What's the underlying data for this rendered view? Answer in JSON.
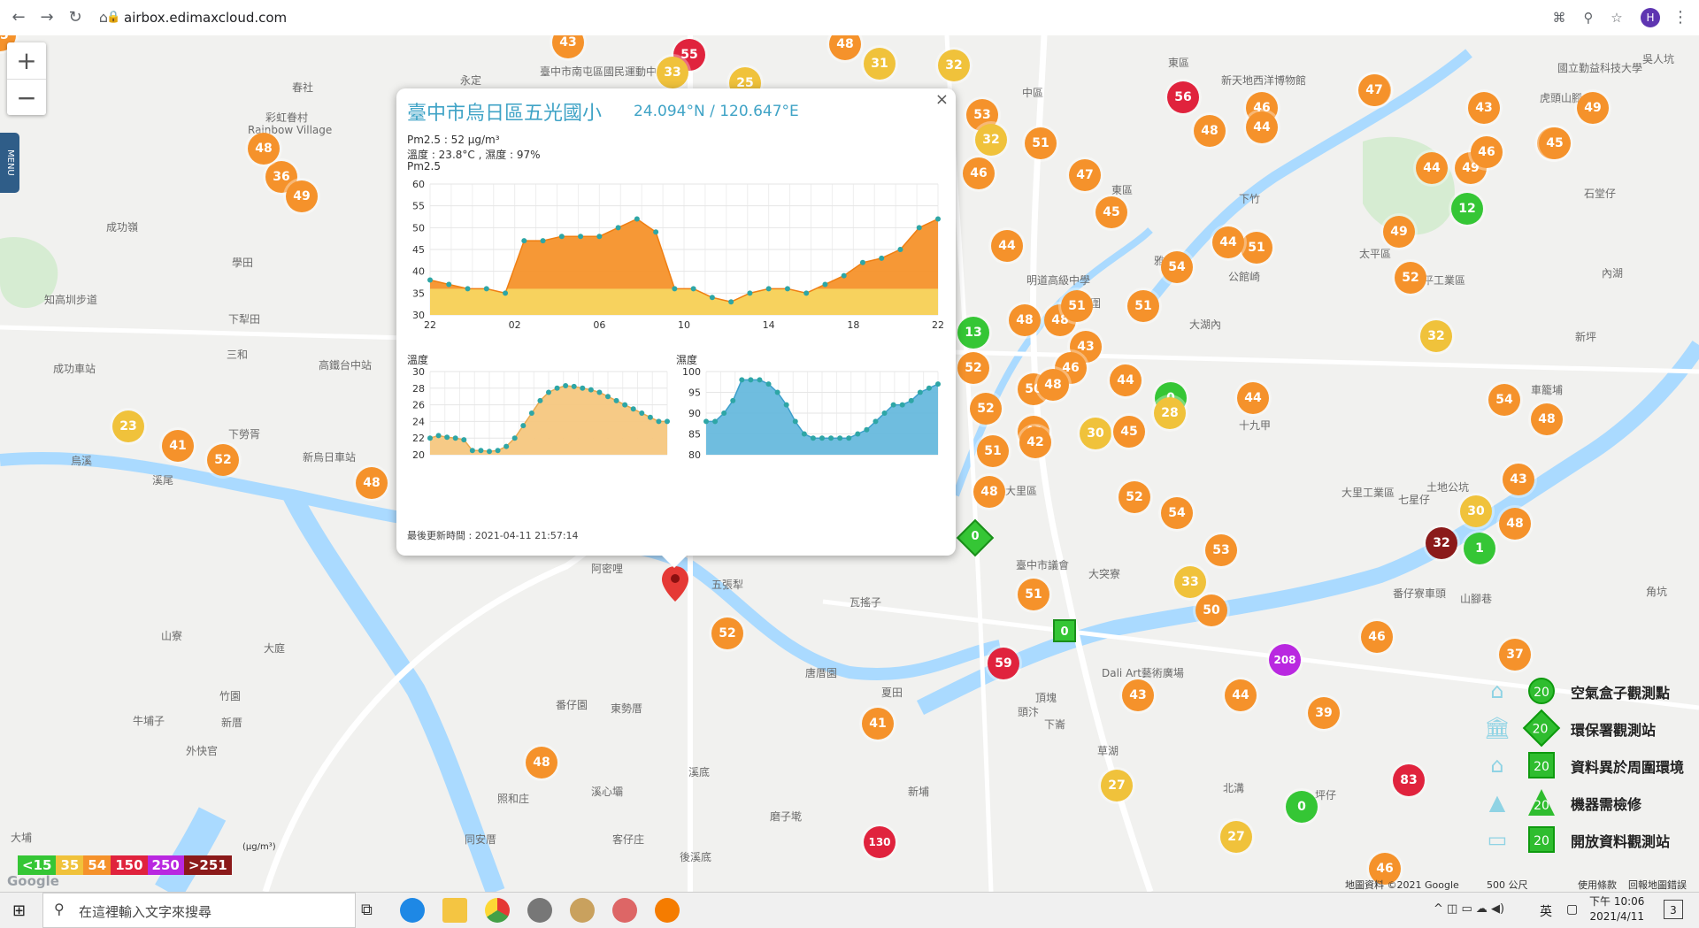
{
  "browser": {
    "url": "airbox.edimaxcloud.com",
    "avatar": "H"
  },
  "map": {
    "menu_label": "MENU",
    "zoom_in": "+",
    "zoom_out": "−",
    "labels": [
      {
        "text": "永定"
      },
      {
        "text": "臺中市南屯區國民運動中心"
      },
      {
        "text": "中區"
      },
      {
        "text": "東區"
      },
      {
        "text": "新天地西洋博物館"
      },
      {
        "text": "國立勤益科技大學"
      },
      {
        "text": "春社"
      },
      {
        "text": "彩虹眷村"
      },
      {
        "text": "成功嶺"
      },
      {
        "text": "學田"
      },
      {
        "text": "知高圳步道"
      },
      {
        "text": "下犁田"
      },
      {
        "text": "三和"
      },
      {
        "text": "成功車站"
      },
      {
        "text": "高鐵台中站"
      },
      {
        "text": "下勞胥"
      },
      {
        "text": "新烏日車站"
      },
      {
        "text": "烏溪"
      },
      {
        "text": "溪尾"
      },
      {
        "text": "阿密哩"
      },
      {
        "text": "五張犁"
      },
      {
        "text": "瓦搖子"
      },
      {
        "text": "番仔園"
      },
      {
        "text": "東勢厝"
      },
      {
        "text": "唐厝園"
      },
      {
        "text": "夏田"
      },
      {
        "text": "山寮"
      },
      {
        "text": "大庭"
      },
      {
        "text": "竹園"
      },
      {
        "text": "牛埔子"
      },
      {
        "text": "新厝"
      },
      {
        "text": "外快官"
      },
      {
        "text": "同安厝"
      },
      {
        "text": "照和庄"
      },
      {
        "text": "溪心壩"
      },
      {
        "text": "客仔庄"
      },
      {
        "text": "溪底"
      },
      {
        "text": "後溪底"
      },
      {
        "text": "磨子墘"
      },
      {
        "text": "新埔"
      },
      {
        "text": "大埔"
      },
      {
        "text": "大里區"
      },
      {
        "text": "大突寮"
      },
      {
        "text": "頂塊"
      },
      {
        "text": "下崙"
      },
      {
        "text": "草湖"
      },
      {
        "text": "北溝"
      },
      {
        "text": "坪仔"
      },
      {
        "text": "大里工業區"
      },
      {
        "text": "七星仔"
      },
      {
        "text": "土地公坑"
      },
      {
        "text": "番仔寮車頭"
      },
      {
        "text": "山腳巷"
      },
      {
        "text": "十九甲"
      },
      {
        "text": "公館崎"
      },
      {
        "text": "大湖內"
      },
      {
        "text": "雅木耳"
      },
      {
        "text": "太平區"
      },
      {
        "text": "太平工業區"
      },
      {
        "text": "新坪"
      },
      {
        "text": "車籠埔"
      },
      {
        "text": "內湖"
      },
      {
        "text": "石堂仔"
      },
      {
        "text": "虎頭山腳"
      },
      {
        "text": "吳人坑"
      },
      {
        "text": "角坑"
      },
      {
        "text": "頭汴"
      },
      {
        "text": "烏竹圍"
      },
      {
        "text": "東區"
      },
      {
        "text": "下竹"
      },
      {
        "text": "Rainbow Village"
      },
      {
        "text": "Dali Art藝術廣場"
      },
      {
        "text": "明道高級中學"
      },
      {
        "text": "臺中市議會"
      }
    ]
  },
  "popup": {
    "title": "臺中市烏日區五光國小",
    "coords": "24.094°N / 120.647°E",
    "pm25_text": "Pm2.5 : 52 μg/m³",
    "temp_hum_text": "溫度 : 23.8°C , 濕度 : 97%",
    "chart_label": "Pm2.5",
    "temp_label": "溫度",
    "hum_label": "濕度",
    "updated": "最後更新時間 : 2021-04-11 21:57:14",
    "close": "×"
  },
  "chart_data": [
    {
      "type": "area",
      "title": "Pm2.5",
      "ylim": [
        30,
        60
      ],
      "yticks": [
        30,
        35,
        40,
        45,
        50,
        55,
        60
      ],
      "xticks": [
        "22",
        "02",
        "06",
        "10",
        "14",
        "18",
        "22"
      ],
      "series": [
        {
          "values": [
            38,
            37,
            36,
            36,
            35,
            47,
            47,
            48,
            48,
            48,
            50,
            52,
            49,
            36,
            36,
            34,
            33,
            35,
            36,
            36,
            35,
            37,
            39,
            42,
            43,
            45,
            50,
            52
          ]
        }
      ],
      "colors": {
        "fill": "#f5922b",
        "line": "#f07f12",
        "point": "#2ea6a6",
        "lowband": "#f7d25e"
      }
    },
    {
      "type": "area",
      "title": "溫度",
      "ylim": [
        20,
        30
      ],
      "yticks": [
        20,
        22,
        24,
        26,
        28,
        30
      ],
      "series": [
        {
          "values": [
            22.0,
            22.3,
            22.1,
            22.0,
            21.8,
            20.5,
            20.5,
            20.4,
            20.5,
            21.0,
            22.0,
            23.5,
            25.0,
            26.5,
            27.5,
            28.0,
            28.3,
            28.2,
            28.0,
            27.8,
            27.5,
            27.0,
            26.5,
            26.0,
            25.5,
            25.0,
            24.5,
            24.0,
            24.0
          ]
        }
      ],
      "colors": {
        "fill": "#f5c77f",
        "line": "#e9a94f",
        "point": "#2ea6a6"
      }
    },
    {
      "type": "area",
      "title": "濕度",
      "ylim": [
        80,
        100
      ],
      "yticks": [
        80,
        85,
        90,
        95,
        100
      ],
      "series": [
        {
          "values": [
            88,
            88,
            90,
            93,
            98,
            98,
            98,
            97,
            95,
            92,
            88,
            85,
            84,
            84,
            84,
            84,
            84,
            85,
            86,
            88,
            90,
            92,
            92,
            93,
            95,
            96,
            97
          ]
        }
      ],
      "colors": {
        "fill": "#67b9dd",
        "line": "#3d9fcb",
        "point": "#2ea6a6"
      }
    }
  ],
  "markers": [
    {
      "v": "43",
      "c": "#f5922b"
    },
    {
      "v": "55",
      "c": "#e0233d"
    },
    {
      "v": "33",
      "c": "#f0c23b"
    },
    {
      "v": "25",
      "c": "#f0c23b"
    },
    {
      "v": "48",
      "c": "#f5922b"
    },
    {
      "v": "31",
      "c": "#f0c23b"
    },
    {
      "v": "32",
      "c": "#f0c23b"
    },
    {
      "v": "53",
      "c": "#f5922b"
    },
    {
      "v": "32",
      "c": "#f0c23b"
    },
    {
      "v": "51",
      "c": "#f5922b"
    },
    {
      "v": "56",
      "c": "#e0233d"
    },
    {
      "v": "48",
      "c": "#f5922b"
    },
    {
      "v": "46",
      "c": "#f5922b"
    },
    {
      "v": "44",
      "c": "#f5922b"
    },
    {
      "v": "47",
      "c": "#f5922b"
    },
    {
      "v": "47",
      "c": "#f5922b"
    },
    {
      "v": "43",
      "c": "#f5922b"
    },
    {
      "v": "45",
      "c": "#f5922b"
    },
    {
      "v": "44",
      "c": "#f5922b"
    },
    {
      "v": "49",
      "c": "#f5922b"
    },
    {
      "v": "46",
      "c": "#f5922b"
    },
    {
      "v": "12",
      "c": "#35c635"
    },
    {
      "v": "49",
      "c": "#f5922b"
    },
    {
      "v": "45",
      "c": "#f5922b"
    },
    {
      "v": "49",
      "c": "#f5922b"
    },
    {
      "v": "36",
      "c": "#f5922b"
    },
    {
      "v": "49",
      "c": "#f5922b"
    },
    {
      "v": "48",
      "c": "#f5922b"
    },
    {
      "v": "46",
      "c": "#f5922b"
    },
    {
      "v": "47",
      "c": "#f5922b"
    },
    {
      "v": "45",
      "c": "#f5922b"
    },
    {
      "v": "44",
      "c": "#f5922b"
    },
    {
      "v": "54",
      "c": "#f5922b"
    },
    {
      "v": "51",
      "c": "#f5922b"
    },
    {
      "v": "52",
      "c": "#f5922b"
    },
    {
      "v": "48",
      "c": "#f5922b"
    },
    {
      "v": "48",
      "c": "#f5922b"
    },
    {
      "v": "51",
      "c": "#f5922b"
    },
    {
      "v": "43",
      "c": "#f5922b"
    },
    {
      "v": "13",
      "c": "#35c635"
    },
    {
      "v": "52",
      "c": "#f5922b"
    },
    {
      "v": "46",
      "c": "#f5922b"
    },
    {
      "v": "50",
      "c": "#f5922b"
    },
    {
      "v": "48",
      "c": "#f5922b"
    },
    {
      "v": "44",
      "c": "#f5922b"
    },
    {
      "v": "0",
      "c": "#35c635"
    },
    {
      "v": "28",
      "c": "#f0c23b"
    },
    {
      "v": "44",
      "c": "#f5922b"
    },
    {
      "v": "52",
      "c": "#f5922b"
    },
    {
      "v": "42",
      "c": "#f5922b"
    },
    {
      "v": "30",
      "c": "#f0c23b"
    },
    {
      "v": "45",
      "c": "#f5922b"
    },
    {
      "v": "51",
      "c": "#f5922b"
    },
    {
      "v": "51",
      "c": "#f5922b"
    },
    {
      "v": "32",
      "c": "#f0c23b"
    },
    {
      "v": "44",
      "c": "#f5922b"
    },
    {
      "v": "54",
      "c": "#f5922b"
    },
    {
      "v": "23",
      "c": "#f0c23b"
    },
    {
      "v": "41",
      "c": "#f5922b"
    },
    {
      "v": "52",
      "c": "#f5922b"
    },
    {
      "v": "48",
      "c": "#f5922b"
    },
    {
      "v": "48",
      "c": "#f5922b"
    },
    {
      "v": "42",
      "c": "#f5922b"
    },
    {
      "v": "52",
      "c": "#f5922b"
    },
    {
      "v": "43",
      "c": "#f5922b"
    },
    {
      "v": "54",
      "c": "#f5922b"
    },
    {
      "v": "48",
      "c": "#f5922b"
    },
    {
      "v": "53",
      "c": "#f5922b"
    },
    {
      "v": "30",
      "c": "#f0c23b"
    },
    {
      "v": "48",
      "c": "#f5922b"
    },
    {
      "v": "32",
      "c": "#8b1a1a"
    },
    {
      "v": "1",
      "c": "#35c635"
    },
    {
      "v": "51",
      "c": "#f5922b"
    },
    {
      "v": "33",
      "c": "#f0c23b"
    },
    {
      "v": "50",
      "c": "#f5922b"
    },
    {
      "v": "46",
      "c": "#f5922b"
    },
    {
      "v": "52",
      "c": "#f5922b"
    },
    {
      "v": "59",
      "c": "#e0233d"
    },
    {
      "v": "208",
      "c": "#b928e0"
    },
    {
      "v": "37",
      "c": "#f5922b"
    },
    {
      "v": "43",
      "c": "#f5922b"
    },
    {
      "v": "44",
      "c": "#f5922b"
    },
    {
      "v": "39",
      "c": "#f5922b"
    },
    {
      "v": "41",
      "c": "#f5922b"
    },
    {
      "v": "130",
      "c": "#e0233d"
    },
    {
      "v": "27",
      "c": "#f0c23b"
    },
    {
      "v": "83",
      "c": "#e0233d"
    },
    {
      "v": "0",
      "c": "#35c635"
    },
    {
      "v": "48",
      "c": "#f5922b"
    },
    {
      "v": "27",
      "c": "#f0c23b"
    },
    {
      "v": "46",
      "c": "#f5922b"
    },
    {
      "v": "45",
      "c": "#f5922b"
    }
  ],
  "station_marks": [
    {
      "v": "0",
      "shape": "diamond"
    },
    {
      "v": "0",
      "shape": "square"
    }
  ],
  "legend": {
    "items": [
      {
        "label": "空氣盒子觀測點",
        "value": "20",
        "icon": "house-icon"
      },
      {
        "label": "環保署觀測站",
        "value": "20",
        "icon": "government-building-icon"
      },
      {
        "label": "資料異於周圍環境",
        "value": "20",
        "icon": "house-icon"
      },
      {
        "label": "機器需檢修",
        "value": "20",
        "icon": "cone-icon"
      },
      {
        "label": "開放資料觀測站",
        "value": "20",
        "icon": "box-icon"
      }
    ],
    "scale": [
      {
        "label": "<15",
        "color": "#35c635"
      },
      {
        "label": "35",
        "color": "#f0c23b"
      },
      {
        "label": "54",
        "color": "#f5922b"
      },
      {
        "label": "150",
        "color": "#e0233d"
      },
      {
        "label": "250",
        "color": "#b928e0"
      },
      {
        "label": ">251",
        "color": "#8b1a1a"
      }
    ],
    "unit": "(μg/m³)"
  },
  "map_footer": {
    "google": "Google",
    "attribution": "地圖資料 ©2021 Google",
    "scale": "500 公尺",
    "terms": "使用條款",
    "report": "回報地圖錯誤"
  },
  "taskbar": {
    "search_placeholder": "在這裡輸入文字來搜尋",
    "ime": "英",
    "time": "下午 10:06",
    "date": "2021/4/11",
    "notifications": "3"
  }
}
